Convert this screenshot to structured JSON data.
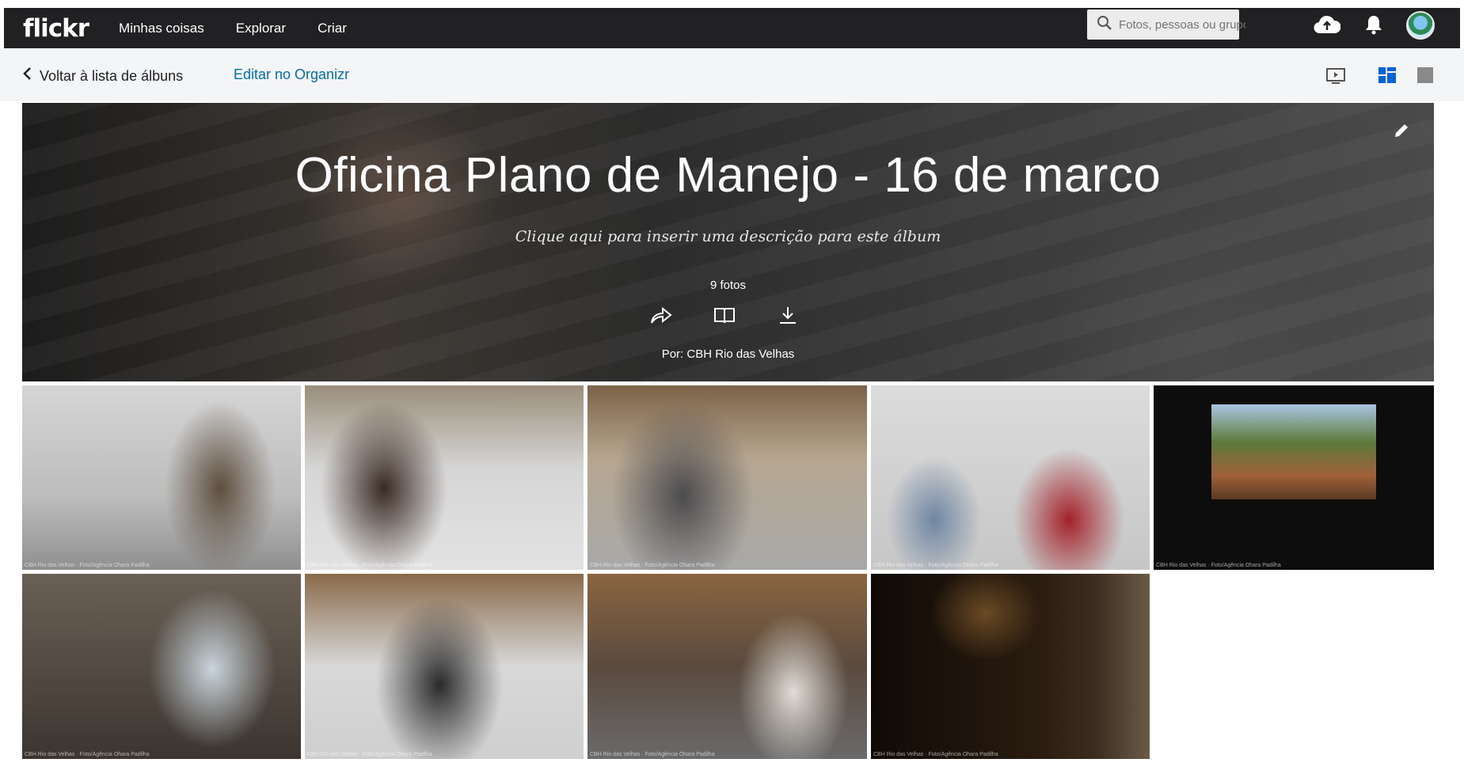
{
  "header": {
    "logo": "flickr",
    "nav": [
      "Minhas coisas",
      "Explorar",
      "Criar"
    ],
    "search_placeholder": "Fotos, pessoas ou grupos"
  },
  "subnav": {
    "back_label": "Voltar à lista de álbuns",
    "edit_label": "Editar no Organizr"
  },
  "album": {
    "title": "Oficina Plano de Manejo - 16 de marco",
    "description": "Clique aqui para inserir uma descrição para este álbum",
    "count": "9 fotos",
    "owner": "Por: CBH Rio das Velhas"
  },
  "photos": [
    {
      "caption": "CBH Rio das Velhas · Foto/Agência Ohara Padilha"
    },
    {
      "caption": "CBH Rio das Velhas · Foto/Agência Ohara Padilha"
    },
    {
      "caption": "CBH Rio das Velhas · Foto/Agência Ohara Padilha"
    },
    {
      "caption": "CBH Rio das Velhas · Foto/Agência Ohara Padilha"
    },
    {
      "caption": "CBH Rio das Velhas · Foto/Agência Ohara Padilha"
    },
    {
      "caption": "CBH Rio das Velhas · Foto/Agência Ohara Padilha"
    },
    {
      "caption": "CBH Rio das Velhas · Foto/Agência Ohara Padilha"
    },
    {
      "caption": "CBH Rio das Velhas · Foto/Agência Ohara Padilha"
    },
    {
      "caption": "CBH Rio das Velhas · Foto/Agência Ohara Padilha"
    }
  ],
  "colors": {
    "topbar": "#212124",
    "link": "#006dac",
    "view_active": "#0063dc",
    "view_inactive": "#898989"
  }
}
